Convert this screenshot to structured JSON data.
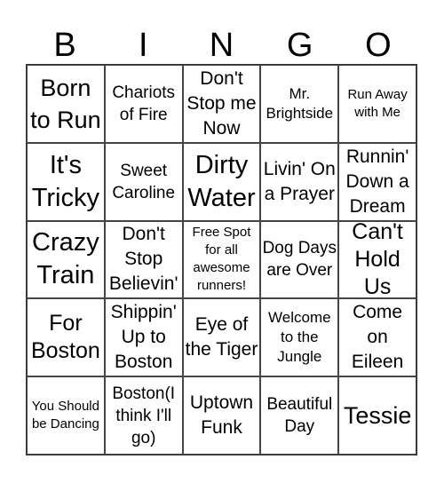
{
  "header": [
    "B",
    "I",
    "N",
    "G",
    "O"
  ],
  "cells": [
    "Born to Run",
    "Chariots of Fire",
    "Don't Stop me Now",
    "Mr. Brightside",
    "Run Away with Me",
    "It's Tricky",
    "Sweet Caroline",
    "Dirty Water",
    "Livin' On a Prayer",
    "Runnin' Down a Dream",
    "Crazy Train",
    "Don't Stop Believin'",
    "Free Spot for all awesome runners!",
    "Dog Days are Over",
    "Can't Hold Us",
    "For Boston",
    "Shippin' Up to Boston",
    "Eye of the Tiger",
    "Welcome to the Jungle",
    "Come on Eileen",
    "You Should be Dancing",
    "Boston(I think I'll go)",
    "Uptown Funk",
    "Beautiful Day",
    "Tessie"
  ]
}
